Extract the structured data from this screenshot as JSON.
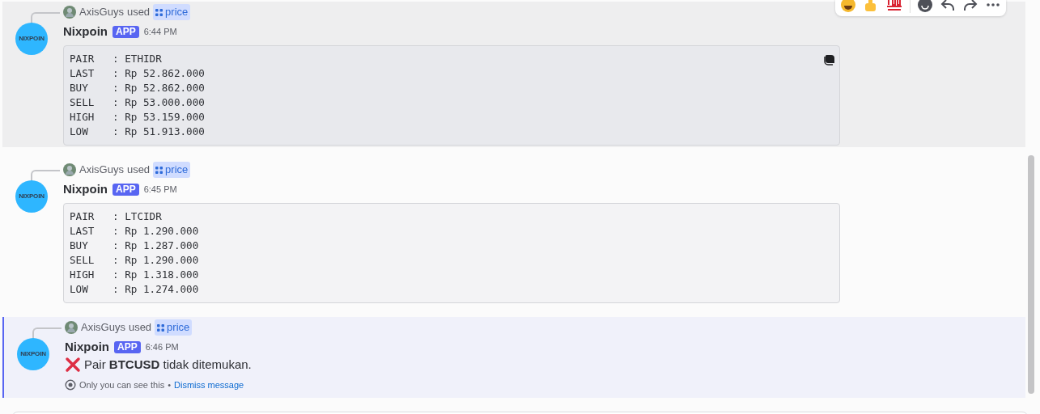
{
  "messages": [
    {
      "reply": {
        "user": "AxisGuys",
        "verb": "used",
        "command": "price"
      },
      "author": "Nixpoin",
      "badge": "APP",
      "time": "6:44 PM",
      "avatar_text": "NIXPOIN",
      "hovered": true,
      "ephemeral": false,
      "kind": "code",
      "code_lines": [
        "PAIR   : ETHIDR",
        "LAST   : Rp 52.862.000",
        "BUY    : Rp 52.862.000",
        "SELL   : Rp 53.000.000",
        "HIGH   : Rp 53.159.000",
        "LOW    : Rp 51.913.000"
      ]
    },
    {
      "reply": {
        "user": "AxisGuys",
        "verb": "used",
        "command": "price"
      },
      "author": "Nixpoin",
      "badge": "APP",
      "time": "6:45 PM",
      "avatar_text": "NIXPOIN",
      "hovered": false,
      "ephemeral": false,
      "kind": "code",
      "code_lines": [
        "PAIR   : LTCIDR",
        "LAST   : Rp 1.290.000",
        "BUY    : Rp 1.287.000",
        "SELL   : Rp 1.290.000",
        "HIGH   : Rp 1.318.000",
        "LOW    : Rp 1.274.000"
      ]
    },
    {
      "reply": {
        "user": "AxisGuys",
        "verb": "used",
        "command": "price"
      },
      "author": "Nixpoin",
      "badge": "APP",
      "time": "6:46 PM",
      "avatar_text": "NIXPOIN",
      "hovered": false,
      "ephemeral": true,
      "kind": "error",
      "text": "Pair **BTCUSD** tidak ditemukan.",
      "note": "Only you can see this",
      "separator": "•",
      "link": "Dismiss message"
    }
  ]
}
